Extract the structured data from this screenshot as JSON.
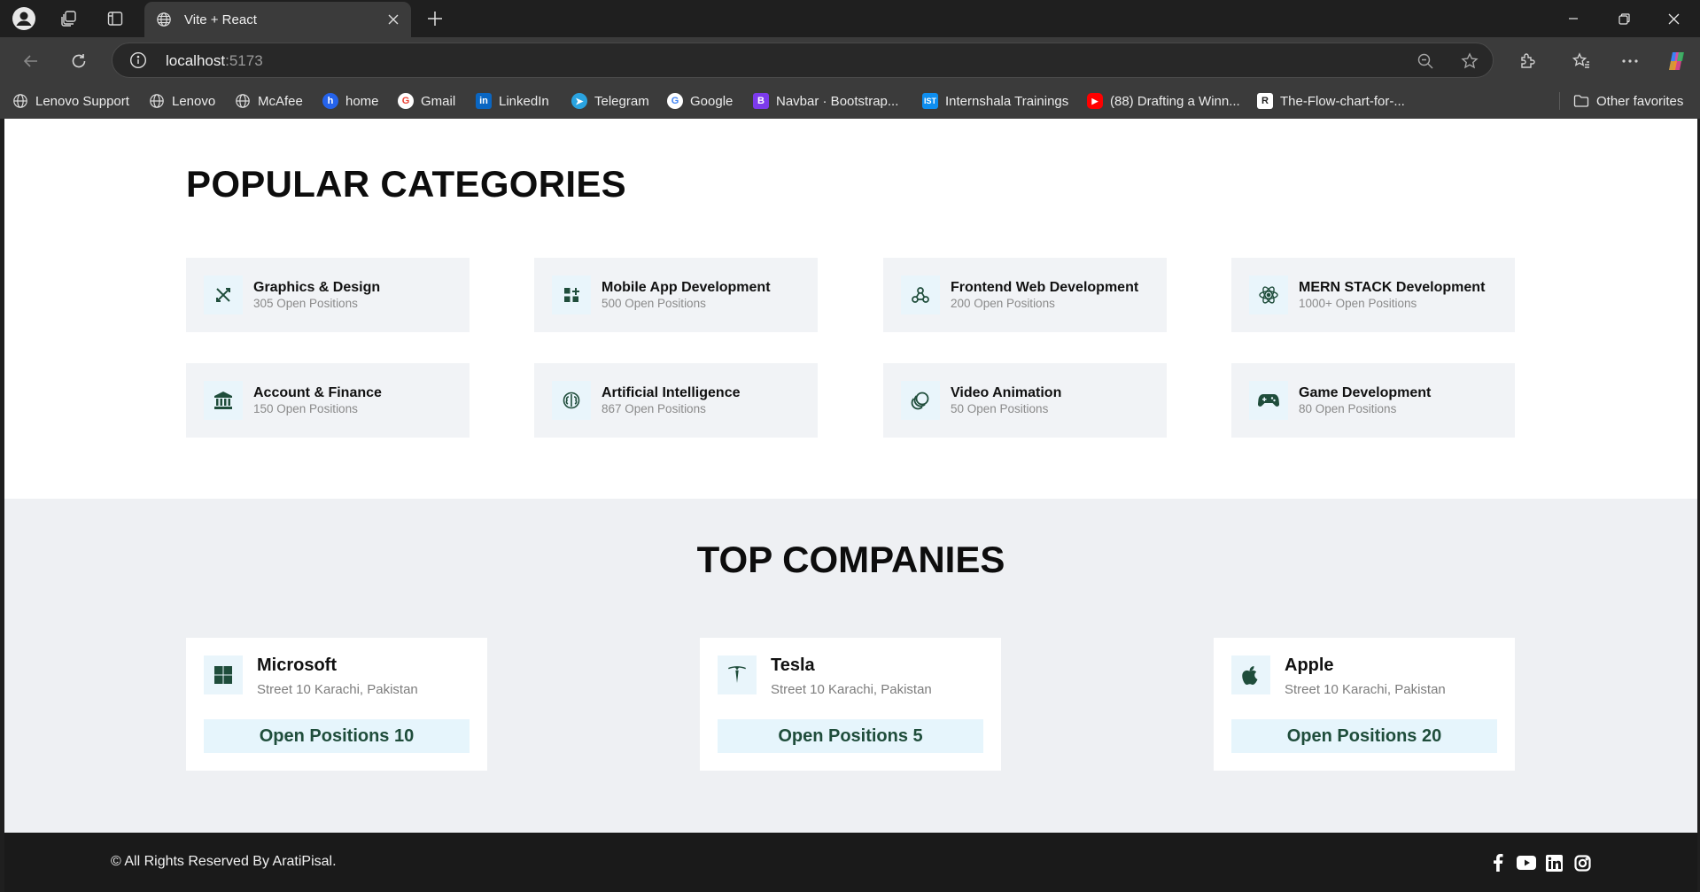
{
  "browser": {
    "tab_title": "Vite + React",
    "url_host": "localhost",
    "url_port": ":5173",
    "bookmarks": [
      {
        "label": "Lenovo Support",
        "icon": "globe-icon"
      },
      {
        "label": "Lenovo",
        "icon": "globe-icon"
      },
      {
        "label": "McAfee",
        "icon": "globe-icon"
      },
      {
        "label": "home",
        "icon": "home-favicon"
      },
      {
        "label": "Gmail",
        "icon": "google-icon"
      },
      {
        "label": "LinkedIn",
        "icon": "linkedin-icon"
      },
      {
        "label": "Telegram",
        "icon": "telegram-icon"
      },
      {
        "label": "Google",
        "icon": "google-icon"
      },
      {
        "label": "Navbar · Bootstrap...",
        "icon": "bootstrap-icon"
      },
      {
        "label": "Internshala Trainings",
        "icon": "internshala-icon"
      },
      {
        "label": "(88) Drafting a Winn...",
        "icon": "youtube-icon"
      },
      {
        "label": "The-Flow-chart-for-...",
        "icon": "replit-icon"
      }
    ],
    "other_favorites": "Other favorites"
  },
  "categories": {
    "title": "POPULAR CATEGORIES",
    "items": [
      {
        "name": "Graphics & Design",
        "count": "305 Open Positions",
        "icon": "design-tools-icon"
      },
      {
        "name": "Mobile App Development",
        "count": "500 Open Positions",
        "icon": "apps-grid-icon"
      },
      {
        "name": "Frontend Web Development",
        "count": "200 Open Positions",
        "icon": "webhook-icon"
      },
      {
        "name": "MERN STACK Development",
        "count": "1000+ Open Positions",
        "icon": "react-atom-icon"
      },
      {
        "name": "Account & Finance",
        "count": "150 Open Positions",
        "icon": "bank-icon"
      },
      {
        "name": "Artificial Intelligence",
        "count": "867 Open Positions",
        "icon": "brain-icon"
      },
      {
        "name": "Video Animation",
        "count": "50 Open Positions",
        "icon": "animation-rings-icon"
      },
      {
        "name": "Game Development",
        "count": "80 Open Positions",
        "icon": "gamepad-icon"
      }
    ]
  },
  "companies": {
    "title": "TOP COMPANIES",
    "items": [
      {
        "name": "Microsoft",
        "location": "Street 10 Karachi, Pakistan",
        "button": "Open Positions 10",
        "icon": "microsoft-logo-icon"
      },
      {
        "name": "Tesla",
        "location": "Street 10 Karachi, Pakistan",
        "button": "Open Positions 5",
        "icon": "tesla-logo-icon"
      },
      {
        "name": "Apple",
        "location": "Street 10 Karachi, Pakistan",
        "button": "Open Positions 20",
        "icon": "apple-logo-icon"
      }
    ]
  },
  "footer": {
    "copyright": "© All Rights Reserved By AratiPisal."
  },
  "colors": {
    "accent": "#1f4d3b",
    "card_bg": "#f1f3f6",
    "icon_bg": "#e9f5fb",
    "footer_bg": "#1a1a1a"
  }
}
